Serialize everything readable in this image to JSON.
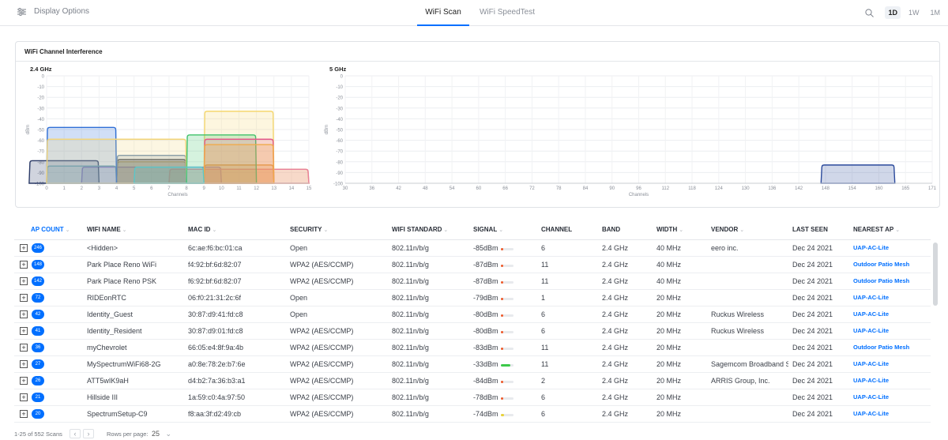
{
  "topbar": {
    "display_options_label": "Display Options",
    "tabs": [
      {
        "label": "WiFi Scan",
        "active": true
      },
      {
        "label": "WiFi SpeedTest",
        "active": false
      }
    ],
    "ranges": [
      {
        "label": "1D",
        "active": true
      },
      {
        "label": "1W",
        "active": false
      },
      {
        "label": "1M",
        "active": false
      }
    ],
    "icons": {
      "display_options": "sliders-icon",
      "search": "search-icon"
    }
  },
  "interference": {
    "title": "WiFi Channel Interference",
    "accent": "#006fff"
  },
  "chart_data": [
    {
      "type": "area",
      "title": "2.4 GHz",
      "xlabel": "Channels",
      "ylabel": "dBm",
      "ylim": [
        -100,
        0
      ],
      "yticks": [
        0,
        -10,
        -20,
        -30,
        -40,
        -50,
        -60,
        -70,
        -80,
        -90,
        -100
      ],
      "xticks": [
        "0",
        "1",
        "2",
        "3",
        "4",
        "5",
        "6",
        "7",
        "8",
        "9",
        "10",
        "11",
        "12",
        "13",
        "14",
        "15"
      ],
      "grid": true,
      "series": [
        {
          "channel": 6,
          "width": 40,
          "signal": -85,
          "color": "#8a6fd6"
        },
        {
          "channel": 11,
          "width": 40,
          "signal": -87,
          "color": "#f0c24a"
        },
        {
          "channel": 11,
          "width": 40,
          "signal": -87,
          "color": "#e87f9b"
        },
        {
          "channel": 1,
          "width": 20,
          "signal": -79,
          "color": "#2b3a67"
        },
        {
          "channel": 6,
          "width": 20,
          "signal": -80,
          "color": "#4c7a68"
        },
        {
          "channel": 6,
          "width": 20,
          "signal": -80,
          "color": "#b3a06b"
        },
        {
          "channel": 11,
          "width": 20,
          "signal": -83,
          "color": "#e29a3c"
        },
        {
          "channel": 11,
          "width": 20,
          "signal": -33,
          "color": "#f5d76e"
        },
        {
          "channel": 2,
          "width": 20,
          "signal": -84,
          "color": "#6aa3b7"
        },
        {
          "channel": 6,
          "width": 20,
          "signal": -78,
          "color": "#2d2f3a"
        },
        {
          "channel": 6,
          "width": 20,
          "signal": -74,
          "color": "#6e8fb3"
        },
        {
          "channel": 2,
          "width": 20,
          "signal": -48,
          "color": "#2f6fd6"
        },
        {
          "channel": 4,
          "width": 40,
          "signal": -59,
          "color": "#f3d57a"
        },
        {
          "channel": 10,
          "width": 20,
          "signal": -55,
          "color": "#41c26a"
        },
        {
          "channel": 11,
          "width": 20,
          "signal": -59,
          "color": "#e45b8a"
        },
        {
          "channel": 11,
          "width": 20,
          "signal": -64,
          "color": "#f0a94a"
        },
        {
          "channel": 7,
          "width": 20,
          "signal": -85,
          "color": "#5bc7c9"
        }
      ]
    },
    {
      "type": "area",
      "title": "5 GHz",
      "xlabel": "Channels",
      "ylabel": "dBm",
      "ylim": [
        -100,
        0
      ],
      "yticks": [
        0,
        -10,
        -20,
        -30,
        -40,
        -50,
        -60,
        -70,
        -80,
        -90,
        -100
      ],
      "xticks": [
        "30",
        "36",
        "42",
        "48",
        "54",
        "60",
        "66",
        "72",
        "78",
        "84",
        "90",
        "96",
        "112",
        "118",
        "124",
        "130",
        "136",
        "142",
        "148",
        "154",
        "160",
        "165",
        "171"
      ],
      "grid": true,
      "series": [
        {
          "channel": 155,
          "width": 80,
          "signal": -83,
          "color": "#2b4a9c"
        }
      ]
    }
  ],
  "table": {
    "columns": [
      {
        "label": "AP COUNT",
        "sorted": true
      },
      {
        "label": "WIFI NAME",
        "sorted": false
      },
      {
        "label": "MAC ID",
        "sorted": false
      },
      {
        "label": "SECURITY",
        "sorted": false
      },
      {
        "label": "WIFI STANDARD",
        "sorted": false
      },
      {
        "label": "SIGNAL",
        "sorted": false
      },
      {
        "label": "CHANNEL",
        "sorted": false
      },
      {
        "label": "BAND",
        "sorted": false
      },
      {
        "label": "WIDTH",
        "sorted": false
      },
      {
        "label": "VENDOR",
        "sorted": false
      },
      {
        "label": "LAST SEEN",
        "sorted": false
      },
      {
        "label": "NEAREST AP",
        "sorted": false
      }
    ],
    "rows": [
      {
        "count": "246",
        "name": "<Hidden>",
        "mac": "6c:ae:f6:bc:01:ca",
        "security": "Open",
        "standard": "802.11n/b/g",
        "signal": "-85dBm",
        "signal_level": 0.15,
        "signal_color": "#ef5a2a",
        "channel": "6",
        "band": "2.4 GHz",
        "width": "40 MHz",
        "vendor": "eero inc.",
        "last_seen": "Dec 24 2021",
        "nearest_ap": "UAP-AC-Lite"
      },
      {
        "count": "148",
        "name": "Park Place Reno WiFi",
        "mac": "f4:92:bf:6d:82:07",
        "security": "WPA2 (AES/CCMP)",
        "standard": "802.11n/b/g",
        "signal": "-87dBm",
        "signal_level": 0.13,
        "signal_color": "#ef5a2a",
        "channel": "11",
        "band": "2.4 GHz",
        "width": "40 MHz",
        "vendor": "",
        "last_seen": "Dec 24 2021",
        "nearest_ap": "Outdoor Patio Mesh"
      },
      {
        "count": "142",
        "name": "Park Place Reno PSK",
        "mac": "f6:92:bf:6d:82:07",
        "security": "WPA2 (AES/CCMP)",
        "standard": "802.11n/b/g",
        "signal": "-87dBm",
        "signal_level": 0.13,
        "signal_color": "#ef5a2a",
        "channel": "11",
        "band": "2.4 GHz",
        "width": "40 MHz",
        "vendor": "",
        "last_seen": "Dec 24 2021",
        "nearest_ap": "Outdoor Patio Mesh"
      },
      {
        "count": "72",
        "name": "RIDEonRTC",
        "mac": "06:f0:21:31:2c:6f",
        "security": "Open",
        "standard": "802.11n/b/g",
        "signal": "-79dBm",
        "signal_level": 0.2,
        "signal_color": "#ef5a2a",
        "channel": "1",
        "band": "2.4 GHz",
        "width": "20 MHz",
        "vendor": "",
        "last_seen": "Dec 24 2021",
        "nearest_ap": "UAP-AC-Lite"
      },
      {
        "count": "42",
        "name": "Identity_Guest",
        "mac": "30:87:d9:41:fd:c8",
        "security": "Open",
        "standard": "802.11n/b/g",
        "signal": "-80dBm",
        "signal_level": 0.18,
        "signal_color": "#ef5a2a",
        "channel": "6",
        "band": "2.4 GHz",
        "width": "20 MHz",
        "vendor": "Ruckus Wireless",
        "last_seen": "Dec 24 2021",
        "nearest_ap": "UAP-AC-Lite"
      },
      {
        "count": "41",
        "name": "Identity_Resident",
        "mac": "30:87:d9:01:fd:c8",
        "security": "WPA2 (AES/CCMP)",
        "standard": "802.11n/b/g",
        "signal": "-80dBm",
        "signal_level": 0.18,
        "signal_color": "#ef5a2a",
        "channel": "6",
        "band": "2.4 GHz",
        "width": "20 MHz",
        "vendor": "Ruckus Wireless",
        "last_seen": "Dec 24 2021",
        "nearest_ap": "UAP-AC-Lite"
      },
      {
        "count": "36",
        "name": "myChevrolet",
        "mac": "66:05:e4:8f:9a:4b",
        "security": "WPA2 (AES/CCMP)",
        "standard": "802.11n/b/g",
        "signal": "-83dBm",
        "signal_level": 0.16,
        "signal_color": "#ef5a2a",
        "channel": "11",
        "band": "2.4 GHz",
        "width": "20 MHz",
        "vendor": "",
        "last_seen": "Dec 24 2021",
        "nearest_ap": "Outdoor Patio Mesh"
      },
      {
        "count": "27",
        "name": "MySpectrumWiFi68-2G",
        "mac": "a0:8e:78:2e:b7:6e",
        "security": "WPA2 (AES/CCMP)",
        "standard": "802.11n/b/g",
        "signal": "-33dBm",
        "signal_level": 0.75,
        "signal_color": "#3cc94a",
        "channel": "11",
        "band": "2.4 GHz",
        "width": "20 MHz",
        "vendor": "Sagemcom Broadband SAS",
        "last_seen": "Dec 24 2021",
        "nearest_ap": "UAP-AC-Lite"
      },
      {
        "count": "26",
        "name": "ATT5wIK9aH",
        "mac": "d4:b2:7a:36:b3:a1",
        "security": "WPA2 (AES/CCMP)",
        "standard": "802.11n/b/g",
        "signal": "-84dBm",
        "signal_level": 0.15,
        "signal_color": "#ef5a2a",
        "channel": "2",
        "band": "2.4 GHz",
        "width": "20 MHz",
        "vendor": "ARRIS Group, Inc.",
        "last_seen": "Dec 24 2021",
        "nearest_ap": "UAP-AC-Lite"
      },
      {
        "count": "21",
        "name": "Hillside III",
        "mac": "1a:59:c0:4a:97:50",
        "security": "WPA2 (AES/CCMP)",
        "standard": "802.11n/b/g",
        "signal": "-78dBm",
        "signal_level": 0.2,
        "signal_color": "#ef5a2a",
        "channel": "6",
        "band": "2.4 GHz",
        "width": "20 MHz",
        "vendor": "",
        "last_seen": "Dec 24 2021",
        "nearest_ap": "UAP-AC-Lite"
      },
      {
        "count": "20",
        "name": "SpectrumSetup-C9",
        "mac": "f8:aa:3f:d2:49:cb",
        "security": "WPA2 (AES/CCMP)",
        "standard": "802.11n/b/g",
        "signal": "-74dBm",
        "signal_level": 0.28,
        "signal_color": "#e8d23a",
        "channel": "6",
        "band": "2.4 GHz",
        "width": "20 MHz",
        "vendor": "",
        "last_seen": "Dec 24 2021",
        "nearest_ap": "UAP-AC-Lite"
      }
    ]
  },
  "footer": {
    "range_text": "1-25 of 552 Scans",
    "rows_per_page_label": "Rows per page:",
    "rows_per_page_value": "25"
  }
}
